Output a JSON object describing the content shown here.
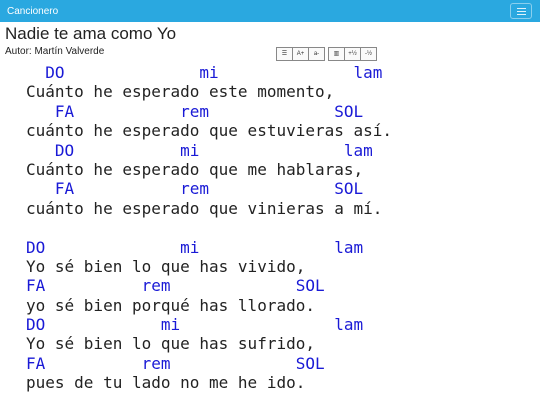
{
  "app": {
    "title": "Cancionero"
  },
  "song": {
    "title": "Nadie te ama como Yo",
    "author": "Autor: Martín Valverde"
  },
  "toolbar": {
    "buttons": [
      "☰",
      "A+",
      "a-",
      "▥",
      "+½",
      "-½"
    ]
  },
  "lines": [
    {
      "type": "chord",
      "text": "  DO              mi              lam"
    },
    {
      "type": "lyric",
      "text": "Cuánto he esperado este momento,"
    },
    {
      "type": "chord",
      "text": "   FA           rem             SOL"
    },
    {
      "type": "lyric",
      "text": "cuánto he esperado que estuvieras así."
    },
    {
      "type": "chord",
      "text": "   DO           mi               lam"
    },
    {
      "type": "lyric",
      "text": "Cuánto he esperado que me hablaras,"
    },
    {
      "type": "chord",
      "text": "   FA           rem             SOL"
    },
    {
      "type": "lyric",
      "text": "cuánto he esperado que vinieras a mí."
    },
    {
      "type": "blank",
      "text": ""
    },
    {
      "type": "chord",
      "text": "DO              mi              lam"
    },
    {
      "type": "lyric",
      "text": "Yo sé bien lo que has vivido,"
    },
    {
      "type": "chord",
      "text": "FA          rem             SOL"
    },
    {
      "type": "lyric",
      "text": "yo sé bien porqué has llorado."
    },
    {
      "type": "chord",
      "text": "DO            mi                lam"
    },
    {
      "type": "lyric",
      "text": "Yo sé bien lo que has sufrido,"
    },
    {
      "type": "chord",
      "text": "FA          rem             SOL"
    },
    {
      "type": "lyric",
      "text": "pues de tu lado no me he ido."
    }
  ]
}
